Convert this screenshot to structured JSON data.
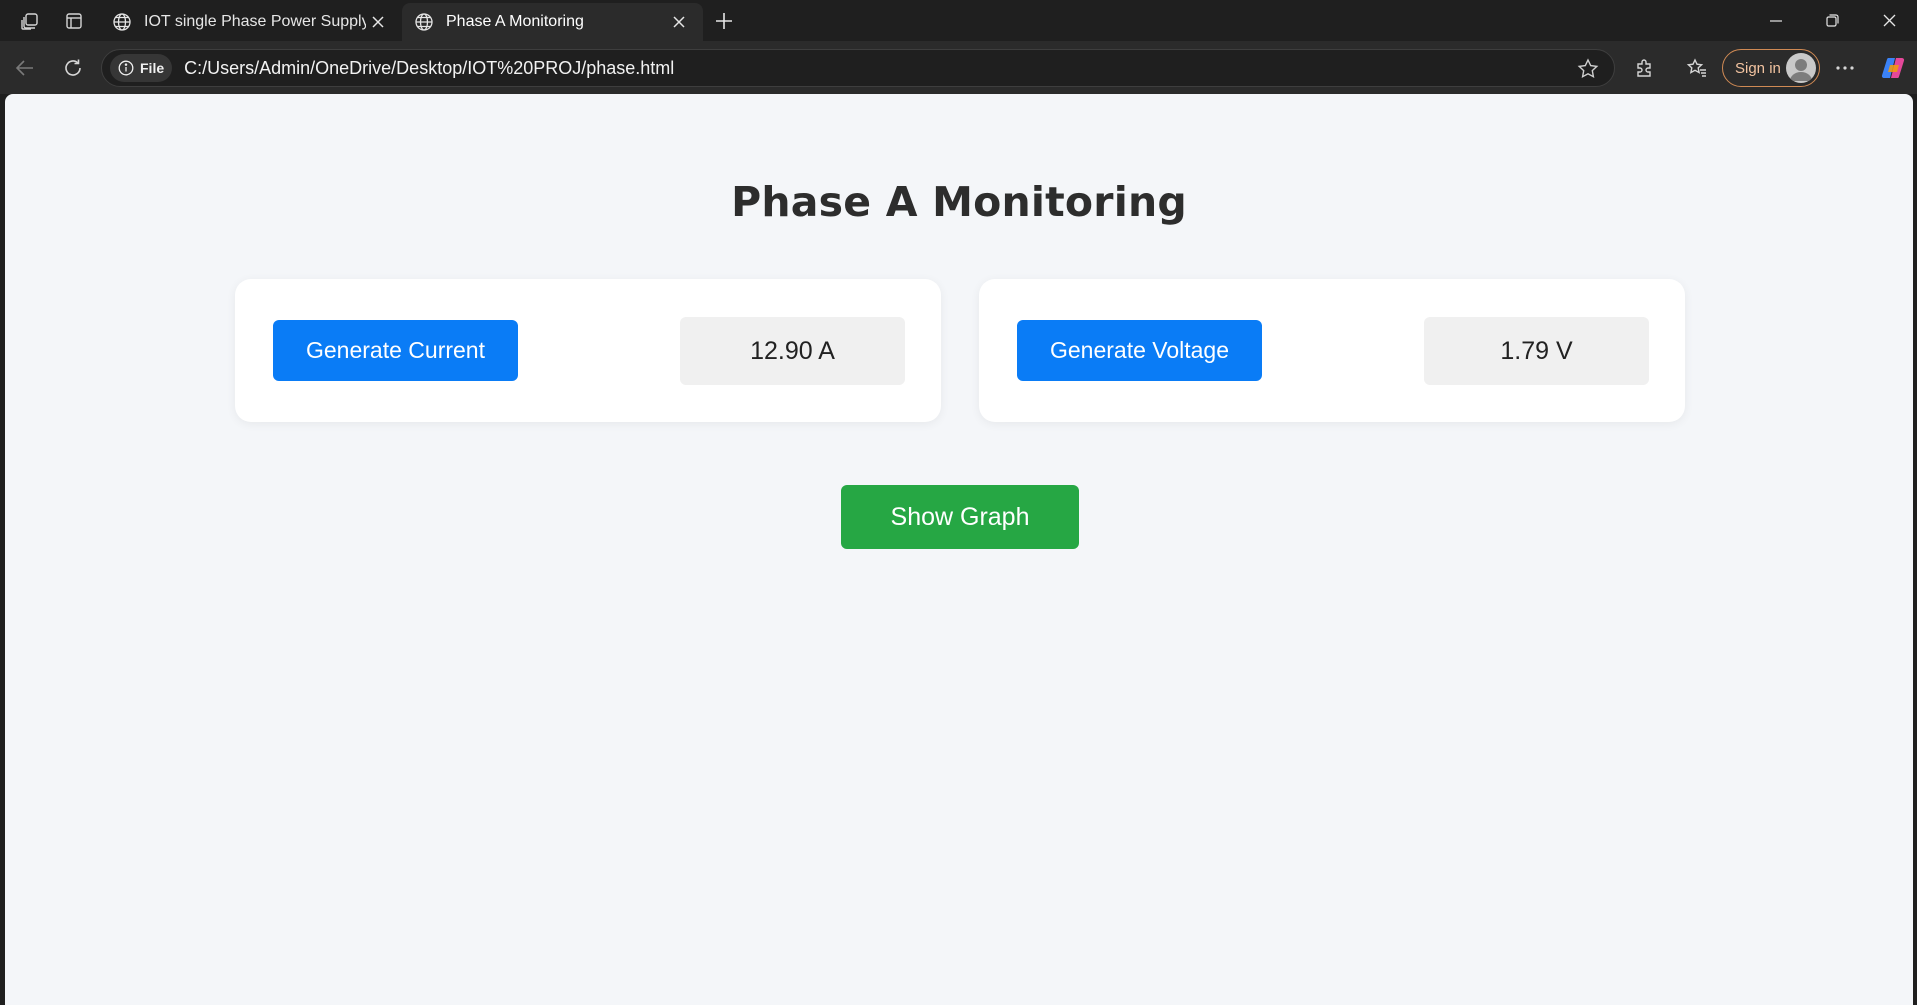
{
  "browser": {
    "tabs": [
      {
        "title": "IOT single Phase Power Supply",
        "icon": "globe-icon",
        "active": false
      },
      {
        "title": "Phase A Monitoring",
        "icon": "globe-icon",
        "active": true
      }
    ],
    "address": {
      "scheme_label": "File",
      "url": "C:/Users/Admin/OneDrive/Desktop/IOT%20PROJ/phase.html"
    },
    "sign_in_label": "Sign in"
  },
  "page": {
    "title": "Phase A Monitoring",
    "current_card": {
      "button_label": "Generate Current",
      "value": "12.90 A"
    },
    "voltage_card": {
      "button_label": "Generate Voltage",
      "value": "1.79 V"
    },
    "show_graph_label": "Show Graph"
  },
  "colors": {
    "primary_button": "#0a7cf6",
    "graph_button": "#26a744",
    "page_background": "#f4f6f9"
  }
}
